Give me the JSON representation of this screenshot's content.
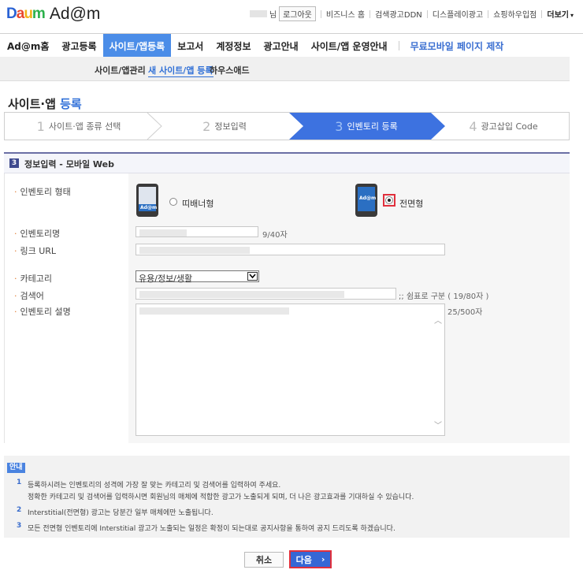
{
  "header": {
    "brand": "Daum",
    "product": "Ad@m",
    "user_suffix": "님",
    "logout": "로그아웃",
    "links": [
      "비즈니스 홈",
      "검색광고DDN",
      "디스플레이광고",
      "쇼핑하우입점"
    ],
    "more": "더보기"
  },
  "gnb": {
    "items": [
      "Ad@m홈",
      "광고등록",
      "사이트/앱등록",
      "보고서",
      "계정정보",
      "광고안내",
      "사이트/앱 운영안내"
    ],
    "promo": "무료모바일 페이지 제작"
  },
  "lnb": {
    "items": [
      "사이트/앱관리",
      "새 사이트/앱 등록",
      "하우스애드"
    ]
  },
  "page": {
    "title_a": "사이트·앱 ",
    "title_b": "등록"
  },
  "steps": [
    {
      "num": "1",
      "label": "사이트·앱 종류 선택"
    },
    {
      "num": "2",
      "label": "정보입력"
    },
    {
      "num": "3",
      "label": "인벤토리 등록"
    },
    {
      "num": "4",
      "label": "광고삽입 Code"
    }
  ],
  "section": {
    "num": "3",
    "title": "정보입력 - 모바일 Web"
  },
  "form": {
    "labels": [
      "인벤토리 형태",
      "인벤토리명",
      "링크 URL",
      "카테고리",
      "검색어",
      "인벤토리 설명"
    ],
    "device_text": "Ad@m",
    "type_options": [
      "띠배너형",
      "전면형"
    ],
    "name_count": "9/40자",
    "category_value": "유용/정보/생활",
    "keyword_hint": ";; 쉼표로 구분 ( 19/80자 )",
    "desc_count": "25/500자"
  },
  "notice": {
    "tag": "안내",
    "items": [
      {
        "num": "1",
        "lines": [
          "등록하시려는 인벤토리의 성격에 가장 잘 맞는 카테고리 및 검색어를 입력하여 주세요.",
          "정확한 카테고리 및 검색어를 입력하시면 회원님의 매체에 적합한 광고가 노출되게 되며, 더 나은 광고효과를 기대하실 수 있습니다."
        ]
      },
      {
        "num": "2",
        "lines": [
          "Interstitial(전면형) 광고는 당분간 일부 매체에만 노출됩니다."
        ]
      },
      {
        "num": "3",
        "lines": [
          "모든 전면형 인벤토리에 Interstitial 광고가 노출되는 일정은 확정이 되는대로 공지사항을 통하여 공지 드리도록 하겠습니다."
        ]
      }
    ]
  },
  "buttons": {
    "cancel": "취소",
    "next": "다음",
    "next_arrow": "›"
  },
  "colors": {
    "accent": "#4b8de8",
    "step_active": "#3d72e0",
    "highlight": "#e0303d"
  }
}
